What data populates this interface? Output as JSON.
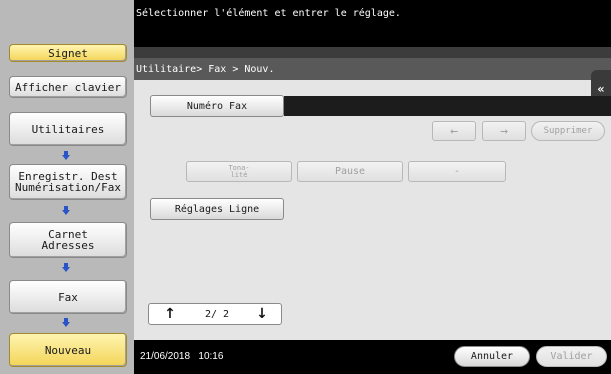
{
  "left": {
    "signet": "Signet",
    "keyboard": "Afficher clavier",
    "nav": [
      "Utilitaires",
      "Enregistr. Dest\nNumérisation/Fax",
      "Carnet\nAdresses",
      "Fax",
      "Nouveau"
    ]
  },
  "top": {
    "instruction": "Sélectionner l'élément et entrer le réglage."
  },
  "crumb": "Utilitaire> Fax > Nouv.",
  "content": {
    "fax_number_label": "Numéro Fax",
    "back_label": "←",
    "forward_label": "→",
    "delete_label": "Supprimer",
    "tone_label": "Tona-\nlité",
    "pause_label": "Pause",
    "dash_label": "-",
    "line_settings_label": "Réglages Ligne",
    "page_indicator": "2/ 2",
    "up_label": "↑",
    "down_label": "↓"
  },
  "status": {
    "datetime": "21/06/2018   10:16"
  },
  "actions": {
    "cancel": "Annuler",
    "ok": "Valider"
  },
  "side_tab": "«"
}
